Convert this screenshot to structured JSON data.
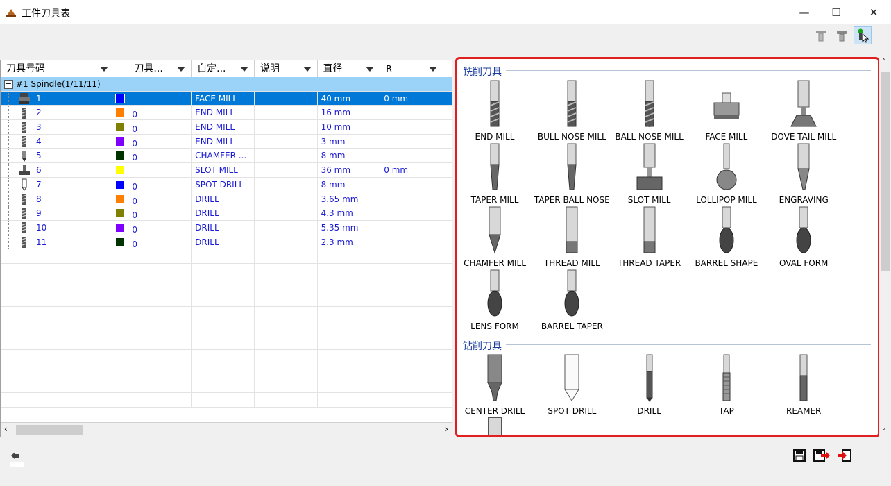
{
  "window": {
    "title": "工件刀具表",
    "minimize": "—",
    "maximize": "☐",
    "close": "✕"
  },
  "toolbar": {
    "icons": [
      "tool-holder-icon",
      "tool-gray-icon",
      "tool-select-icon"
    ]
  },
  "table": {
    "columns": [
      "刀具号码",
      "",
      "刀具...",
      "自定...",
      "说明",
      "直径",
      "R"
    ],
    "group": "#1 Spindle(1/11/11)",
    "rows": [
      {
        "num": "1",
        "color": "#0000ff",
        "v1": "",
        "type": "FACE MILL",
        "desc": "",
        "dia": "40 mm",
        "r": "0 mm",
        "icon": "face-mill-icon"
      },
      {
        "num": "2",
        "color": "#ff7f00",
        "v1": "0",
        "type": "END MILL",
        "desc": "",
        "dia": "16 mm",
        "r": "",
        "icon": "end-mill-icon"
      },
      {
        "num": "3",
        "color": "#808000",
        "v1": "0",
        "type": "END MILL",
        "desc": "",
        "dia": "10 mm",
        "r": "",
        "icon": "end-mill-icon"
      },
      {
        "num": "4",
        "color": "#8000ff",
        "v1": "0",
        "type": "END MILL",
        "desc": "",
        "dia": "3 mm",
        "r": "",
        "icon": "end-mill-icon"
      },
      {
        "num": "5",
        "color": "#003300",
        "v1": "0",
        "type": "CHAMFER ...",
        "desc": "",
        "dia": "8 mm",
        "r": "",
        "icon": "chamfer-mill-icon"
      },
      {
        "num": "6",
        "color": "#ffff00",
        "v1": "",
        "type": "SLOT MILL",
        "desc": "",
        "dia": "36 mm",
        "r": "0 mm",
        "icon": "slot-mill-icon"
      },
      {
        "num": "7",
        "color": "#0000ff",
        "v1": "0",
        "type": "SPOT DRILL",
        "desc": "",
        "dia": "8 mm",
        "r": "",
        "icon": "spot-drill-icon"
      },
      {
        "num": "8",
        "color": "#ff7f00",
        "v1": "0",
        "type": "DRILL",
        "desc": "",
        "dia": "3.65 mm",
        "r": "",
        "icon": "drill-icon"
      },
      {
        "num": "9",
        "color": "#808000",
        "v1": "0",
        "type": "DRILL",
        "desc": "",
        "dia": "4.3 mm",
        "r": "",
        "icon": "drill-icon"
      },
      {
        "num": "10",
        "color": "#8000ff",
        "v1": "0",
        "type": "DRILL",
        "desc": "",
        "dia": "5.35 mm",
        "r": "",
        "icon": "drill-icon"
      },
      {
        "num": "11",
        "color": "#003300",
        "v1": "0",
        "type": "DRILL",
        "desc": "",
        "dia": "2.3 mm",
        "r": "",
        "icon": "drill-icon"
      }
    ]
  },
  "panel": {
    "milling_title": "铣削刀具",
    "milling": [
      "END MILL",
      "BULL NOSE MILL",
      "BALL NOSE MILL",
      "FACE MILL",
      "DOVE TAIL MILL",
      "TAPER MILL",
      "TAPER BALL NOSE",
      "SLOT MILL",
      "LOLLIPOP MILL",
      "ENGRAVING",
      "CHAMFER MILL",
      "THREAD MILL",
      "THREAD TAPER",
      "BARREL SHAPE",
      "OVAL FORM",
      "LENS FORM",
      "BARREL TAPER"
    ],
    "drilling_title": "钻削刀具",
    "drilling": [
      "CENTER DRILL",
      "SPOT DRILL",
      "DRILL",
      "TAP",
      "REAMER"
    ]
  },
  "bottom": {
    "left_icon": "back-arrow-icon",
    "right_icons": [
      "save-icon",
      "save-export-icon",
      "exit-icon"
    ]
  }
}
